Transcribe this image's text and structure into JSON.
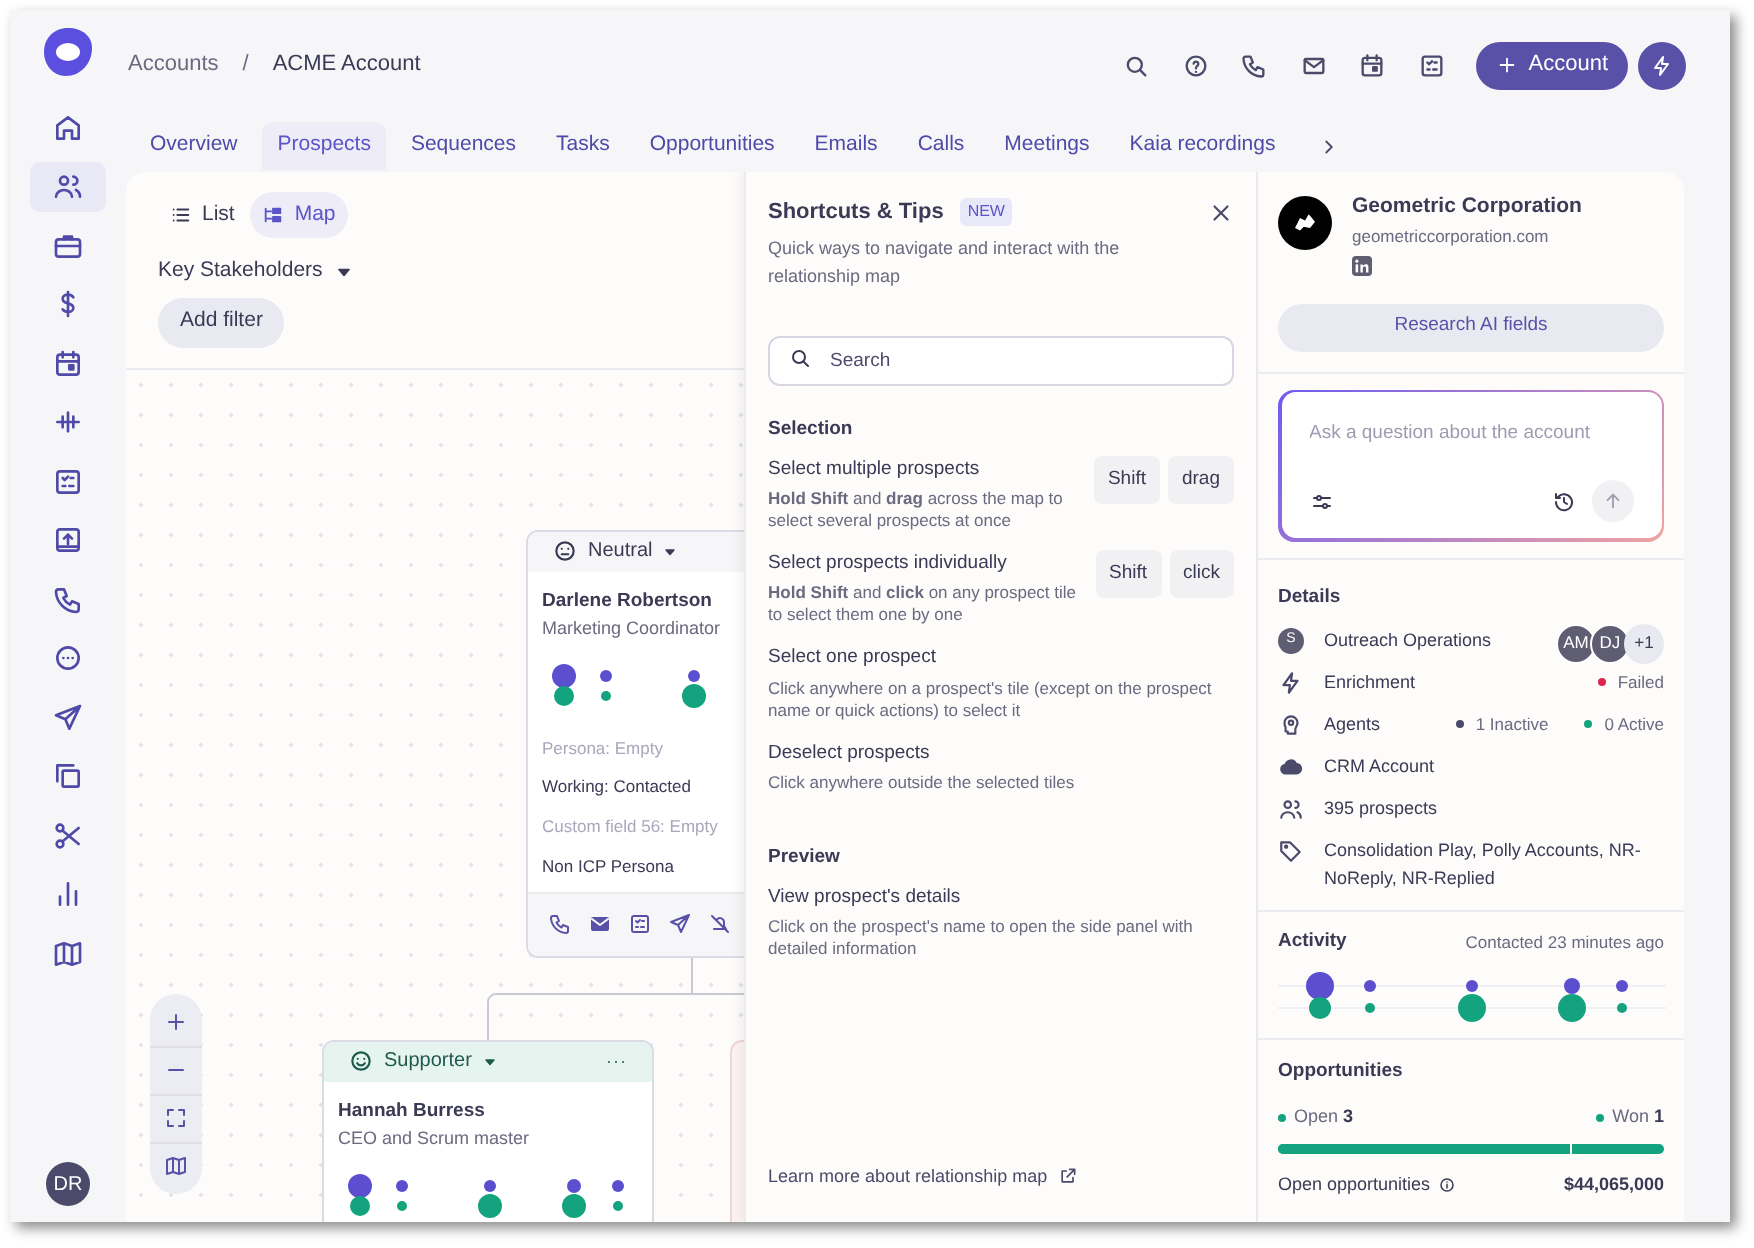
{
  "sidebar_items": [
    {
      "selected": false
    },
    {
      "selected": true
    },
    {
      "selected": false
    },
    {
      "selected": false
    },
    {
      "selected": false
    },
    {
      "selected": false
    },
    {
      "selected": false
    },
    {
      "selected": false
    },
    {
      "selected": false
    },
    {
      "selected": false
    },
    {
      "selected": false
    },
    {
      "selected": false
    },
    {
      "selected": false
    },
    {
      "selected": false
    },
    {
      "selected": false
    }
  ],
  "user_avatar": "DR",
  "breadcrumb": {
    "items": [
      "Accounts",
      "ACME Account"
    ],
    "separator": "/"
  },
  "header": {
    "primary_button": "Account"
  },
  "tabs": [
    {
      "label": "Overview",
      "selected": false
    },
    {
      "label": "Prospects",
      "selected": true
    },
    {
      "label": "Sequences",
      "selected": false
    },
    {
      "label": "Tasks",
      "selected": false
    },
    {
      "label": "Opportunities",
      "selected": false
    },
    {
      "label": "Emails",
      "selected": false
    },
    {
      "label": "Calls",
      "selected": false
    },
    {
      "label": "Meetings",
      "selected": false
    },
    {
      "label": "Kaia recordings",
      "selected": false
    }
  ],
  "view_toggle": [
    {
      "label": "List",
      "selected": false
    },
    {
      "label": "Map",
      "selected": true
    }
  ],
  "filter": {
    "dropdown": "Key Stakeholders",
    "add_filter": "Add filter"
  },
  "prospect_cards": [
    {
      "kind": "neutral",
      "sentiment": "Neutral",
      "name": "Darlene Robertson",
      "title": "Marketing Coordinator",
      "fields": [
        {
          "text": "Persona: Empty",
          "empty": true
        },
        {
          "text": "Working: Contacted",
          "empty": false
        },
        {
          "text": "Custom field 56: Empty",
          "empty": true
        },
        {
          "text": "Non ICP Persona",
          "empty": false
        }
      ]
    },
    {
      "kind": "supporter",
      "sentiment": "Supporter",
      "name": "Hannah Burress",
      "title": "CEO and Scrum master"
    }
  ],
  "shortcuts": {
    "title": "Shortcuts & Tips",
    "badge": "NEW",
    "subtitle": "Quick ways to navigate and interact with the relationship map",
    "search_placeholder": "Search",
    "sections": [
      {
        "heading": "Selection",
        "items": [
          {
            "title": "Select multiple prospects",
            "description": "**Hold Shift** and **drag** across the map to select several prospects at once",
            "keys": [
              "Shift",
              "drag"
            ]
          },
          {
            "title": "Select prospects individually",
            "description": "**Hold Shift** and **click** on any prospect tile to select them one by one",
            "keys": [
              "Shift",
              "click"
            ]
          },
          {
            "title": "Select one prospect",
            "description": "Click anywhere on a prospect's tile (except on the prospect name or quick actions) to select it"
          },
          {
            "title": "Deselect prospects",
            "description": "Click anywhere outside the selected tiles"
          }
        ]
      },
      {
        "heading": "Preview",
        "items": [
          {
            "title": "View prospect's details",
            "description": "Click on the prospect's name to open the side panel with detailed information"
          }
        ]
      }
    ],
    "footer_link": "Learn more about relationship map"
  },
  "account": {
    "name": "Geometric Corporation",
    "domain": "geometriccorporation.com",
    "research_button": "Research AI fields",
    "ask_placeholder": "Ask a question about the account",
    "details": {
      "heading": "Details",
      "rows": [
        {
          "kind": "owner",
          "badge": "S",
          "label": "Outreach Operations",
          "avatars": [
            "AM",
            "DJ",
            "+1"
          ]
        },
        {
          "kind": "enrichment",
          "label": "Enrichment",
          "statuses": [
            {
              "text": "Failed",
              "color": "#dc2650"
            }
          ]
        },
        {
          "kind": "agents",
          "label": "Agents",
          "statuses": [
            {
              "text": "1 Inactive",
              "color": "#4b4a6b"
            },
            {
              "text": "0 Active",
              "color": "#14a37f"
            }
          ]
        },
        {
          "kind": "crm",
          "label": "CRM Account"
        },
        {
          "kind": "prospects",
          "label": "395 prospects"
        },
        {
          "kind": "tags",
          "label": "Consolidation Play, Polly Accounts, NR-NoReply, NR-Replied"
        }
      ]
    },
    "activity": {
      "heading": "Activity",
      "last_contacted": "Contacted 23 minutes ago"
    },
    "opportunities": {
      "heading": "Opportunities",
      "open_label": "Open",
      "open_count": "3",
      "won_label": "Won",
      "won_count": "1",
      "level": 0.76,
      "summary_label": "Open opportunities",
      "summary_value": "$44,065,000"
    }
  }
}
